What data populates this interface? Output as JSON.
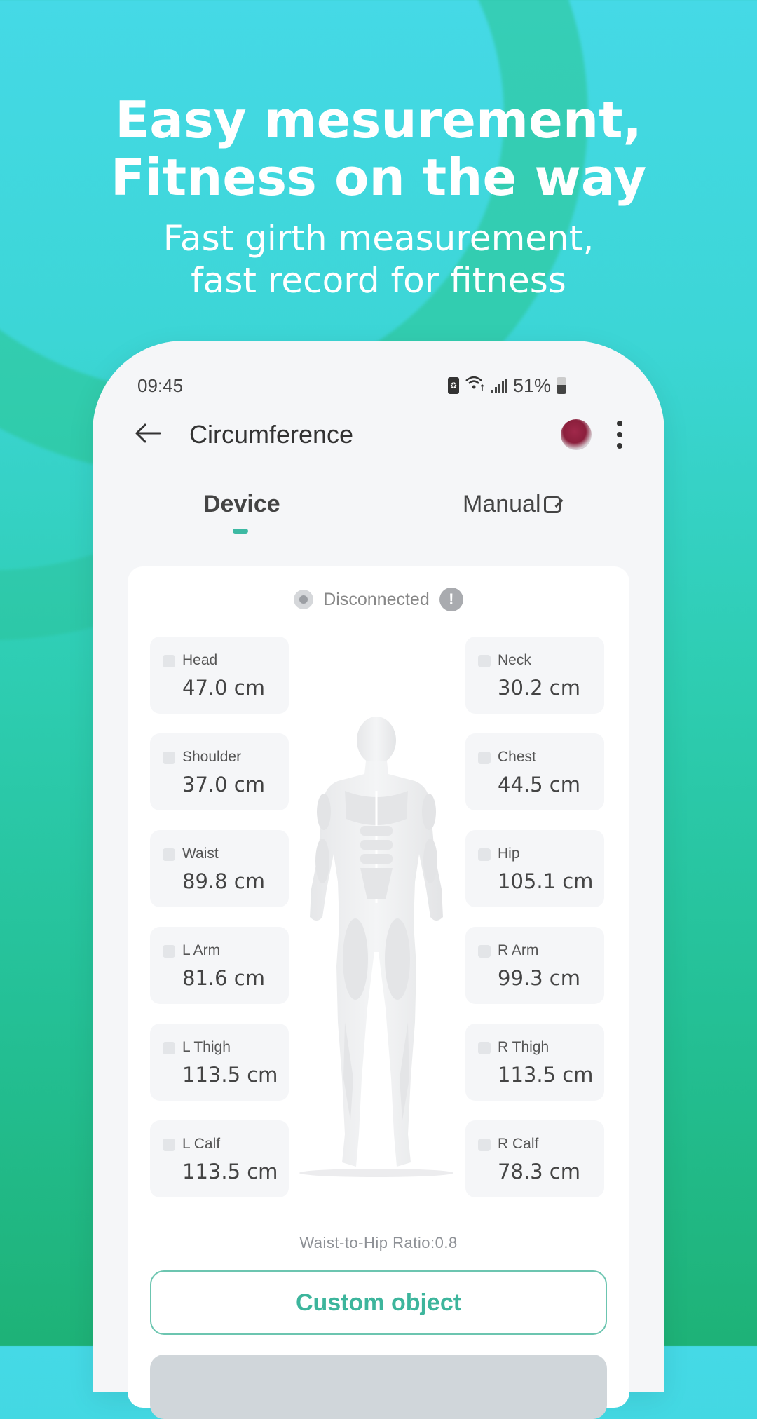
{
  "hero": {
    "headline_line1": "Easy mesurement,",
    "headline_line2": "Fitness on the way",
    "subtitle_line1": "Fast girth measurement,",
    "subtitle_line2": "fast record for fitness"
  },
  "status_bar": {
    "time": "09:45",
    "battery_percent": "51%",
    "icons": [
      "battery-saver-icon",
      "wifi-icon",
      "signal-icon",
      "battery-icon"
    ]
  },
  "app_bar": {
    "back_icon": "arrow-left-icon",
    "title": "Circumference",
    "avatar": "user-avatar",
    "more_icon": "more-vertical-icon"
  },
  "tabs": [
    {
      "label": "Device",
      "active": true
    },
    {
      "label": "Manual",
      "active": false,
      "icon": "edit-icon"
    }
  ],
  "connection": {
    "status": "Disconnected",
    "info_icon": "!"
  },
  "measurements": {
    "left": [
      {
        "label": "Head",
        "value": "47.0 cm"
      },
      {
        "label": "Shoulder",
        "value": "37.0 cm"
      },
      {
        "label": "Waist",
        "value": "89.8 cm"
      },
      {
        "label": "L Arm",
        "value": "81.6 cm"
      },
      {
        "label": "L Thigh",
        "value": "113.5 cm"
      },
      {
        "label": "L Calf",
        "value": "113.5 cm"
      }
    ],
    "right": [
      {
        "label": "Neck",
        "value": "30.2 cm"
      },
      {
        "label": "Chest",
        "value": "44.5 cm"
      },
      {
        "label": "Hip",
        "value": "105.1 cm"
      },
      {
        "label": "R Arm",
        "value": "99.3 cm"
      },
      {
        "label": "R Thigh",
        "value": "113.5 cm"
      },
      {
        "label": "R Calf",
        "value": "78.3 cm"
      }
    ]
  },
  "ratio_text": "Waist-to-Hip Ratio:0.8",
  "buttons": {
    "custom_object": "Custom object"
  },
  "colors": {
    "accent": "#3db59c",
    "bg_top": "#45d9e6",
    "bg_bottom": "#1eb277"
  }
}
